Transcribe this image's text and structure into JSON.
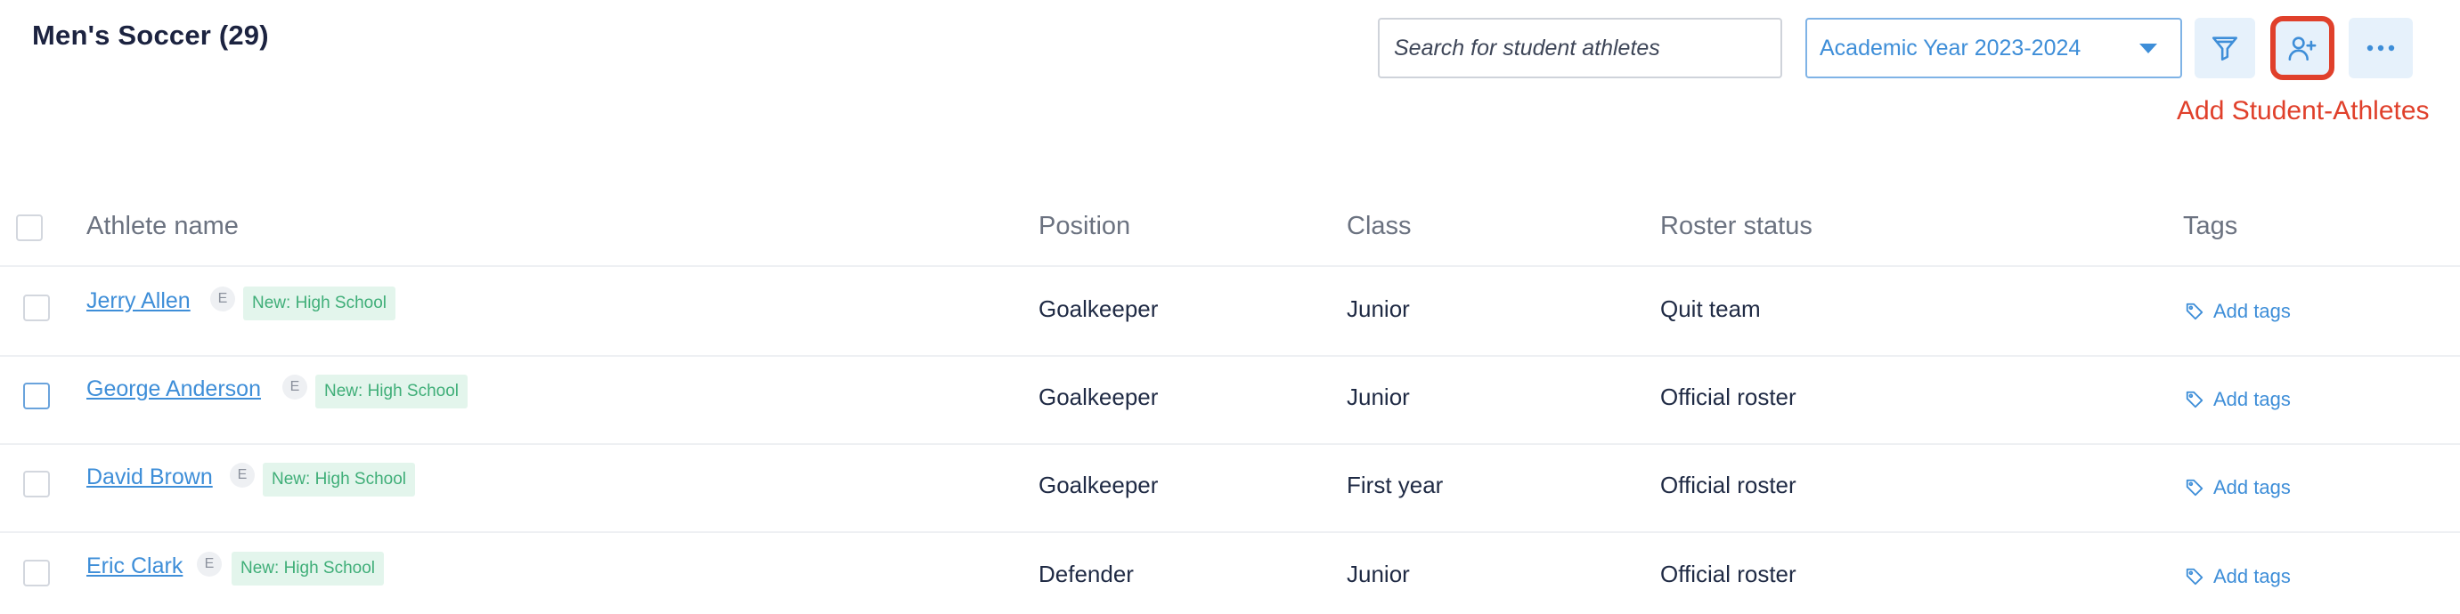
{
  "header": {
    "title": "Men's Soccer (29)",
    "search_placeholder": "Search for student athletes",
    "year_select": "Academic Year 2023-2024",
    "annotation": "Add Student-Athletes"
  },
  "icons": {
    "filter": "filter-icon",
    "add_user": "add-user-icon",
    "more": "more-horizontal-icon",
    "tag": "tag-icon"
  },
  "colors": {
    "accent": "#3e8ed8",
    "highlight": "#e0402b",
    "tag_bg": "#e3f5ec",
    "tag_text": "#3fae78"
  },
  "table": {
    "columns": [
      "Athlete name",
      "Position",
      "Class",
      "Roster status",
      "Tags"
    ],
    "rows": [
      {
        "name": "Jerry Allen",
        "badge": "E",
        "tag": "New: High School",
        "position": "Goalkeeper",
        "class": "Junior",
        "status": "Quit team",
        "tags_action": "Add tags"
      },
      {
        "name": "George Anderson",
        "badge": "E",
        "tag": "New: High School",
        "position": "Goalkeeper",
        "class": "Junior",
        "status": "Official roster",
        "tags_action": "Add tags"
      },
      {
        "name": "David Brown",
        "badge": "E",
        "tag": "New: High School",
        "position": "Goalkeeper",
        "class": "First year",
        "status": "Official roster",
        "tags_action": "Add tags"
      },
      {
        "name": "Eric Clark",
        "badge": "E",
        "tag": "New: High School",
        "position": "Defender",
        "class": "Junior",
        "status": "Official roster",
        "tags_action": "Add tags"
      }
    ]
  }
}
